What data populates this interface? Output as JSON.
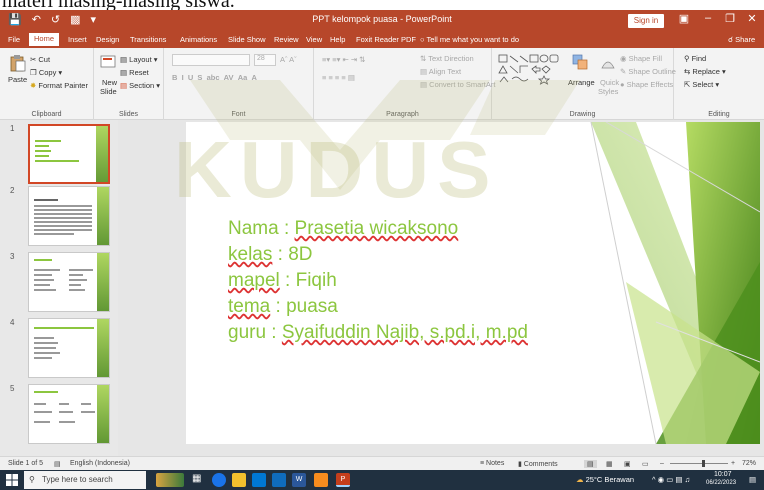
{
  "doc_strip": {
    "text": "materi masing-masing siswa."
  },
  "window": {
    "title": "PPT kelompok puasa  -  PowerPoint",
    "sign_in": "Sign in"
  },
  "tabs": [
    "File",
    "Home",
    "Insert",
    "Design",
    "Transitions",
    "Animations",
    "Slide Show",
    "Review",
    "View",
    "Help",
    "Foxit Reader PDF",
    "Tell me what you want to do",
    "Share"
  ],
  "ribbon": {
    "clipboard": {
      "paste": "Paste",
      "cut": "Cut",
      "copy": "Copy",
      "format_painter": "Format Painter",
      "label": "Clipboard"
    },
    "slides": {
      "new_slide": "New",
      "new_slide2": "Slide",
      "layout": "Layout",
      "reset": "Reset",
      "section": "Section",
      "label": "Slides"
    },
    "font": {
      "size": "28",
      "label": "Font"
    },
    "paragraph": {
      "text_direction": "Text Direction",
      "align_text": "Align Text",
      "convert": "Convert to SmartArt",
      "label": "Paragraph"
    },
    "drawing": {
      "arrange": "Arrange",
      "quick_styles": "Quick",
      "quick_styles2": "Styles",
      "shape_fill": "Shape Fill",
      "shape_outline": "Shape Outline",
      "shape_effects": "Shape Effects",
      "label": "Drawing"
    },
    "editing": {
      "find": "Find",
      "replace": "Replace",
      "select": "Select",
      "label": "Editing"
    }
  },
  "watermark": {
    "text": "KUDUS"
  },
  "thumbnails": [
    {
      "num": "1"
    },
    {
      "num": "2"
    },
    {
      "num": "3"
    },
    {
      "num": "4"
    },
    {
      "num": "5"
    }
  ],
  "slide": {
    "lines": [
      {
        "label": "Nama : ",
        "value": "Prasetia wicaksono"
      },
      {
        "label": "kelas",
        "value": " : 8D"
      },
      {
        "label": "mapel",
        "value": " : Fiqih"
      },
      {
        "label": "tema",
        "value": " : puasa"
      },
      {
        "label": "guru : ",
        "value": "Syaifuddin Najib, s.pd.i, m.pd"
      }
    ]
  },
  "status": {
    "slide_of": "Slide 1 of 5",
    "language": "English (Indonesia)",
    "notes": "Notes",
    "comments": "Comments",
    "zoom": "72%"
  },
  "taskbar": {
    "search_placeholder": "Type here to search",
    "weather": "25°C  Berawan",
    "time": "10:07",
    "date": "06/22/2023"
  },
  "colors": {
    "accent": "#b7472a",
    "slide_text": "#8cc63f",
    "taskbar": "#203040"
  }
}
